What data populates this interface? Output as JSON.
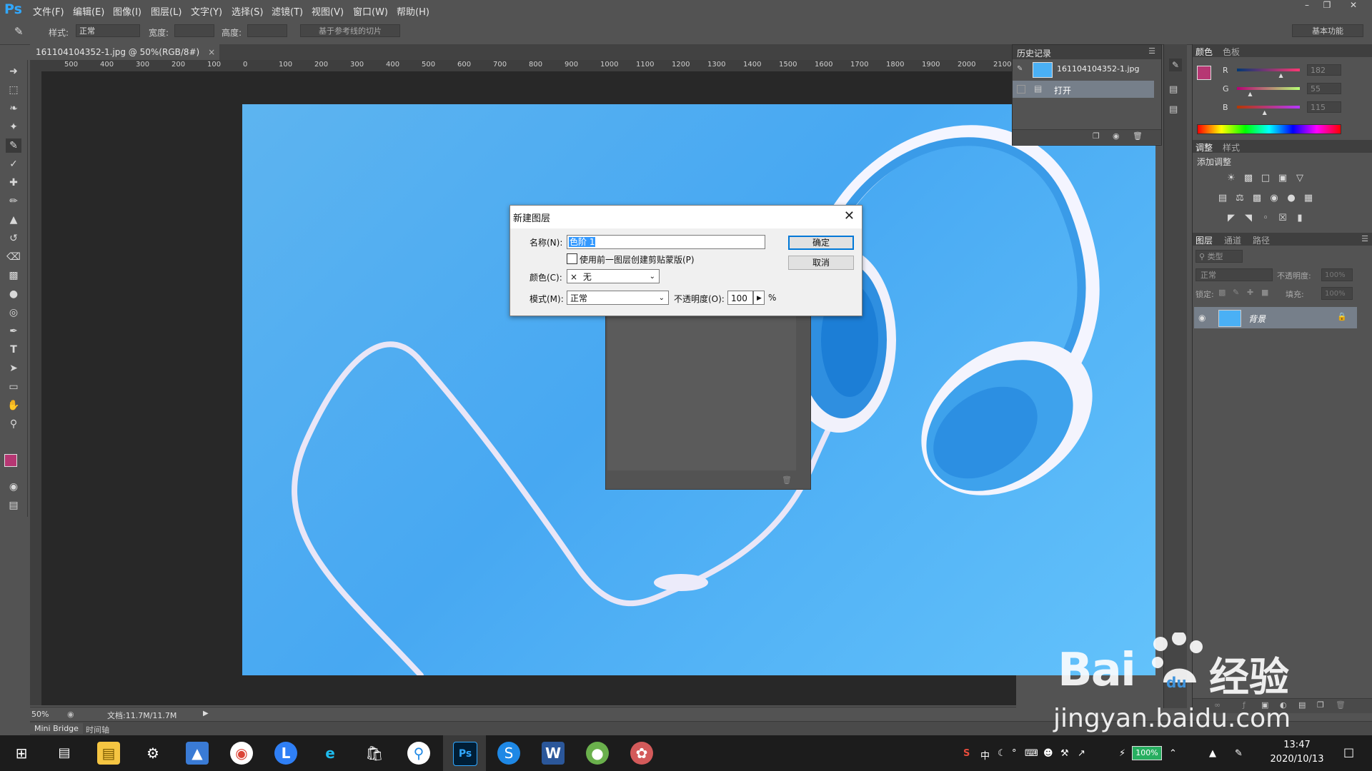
{
  "app": {
    "logo": "Ps",
    "menus": [
      "文件(F)",
      "编辑(E)",
      "图像(I)",
      "图层(L)",
      "文字(Y)",
      "选择(S)",
      "滤镜(T)",
      "视图(V)",
      "窗口(W)",
      "帮助(H)"
    ],
    "workspace": "基本功能"
  },
  "options_bar": {
    "style_label": "样式:",
    "style_value": "正常",
    "width_label": "宽度:",
    "height_label": "高度:",
    "slice_button": "基于参考线的切片"
  },
  "document": {
    "tab_title": "161104104352-1.jpg @ 50%(RGB/8#)",
    "ruler_labels": [
      "500",
      "400",
      "300",
      "200",
      "100",
      "0",
      "100",
      "200",
      "300",
      "400",
      "500",
      "600",
      "700",
      "800",
      "900",
      "1000",
      "1100",
      "1200",
      "1300",
      "1400",
      "1500",
      "1600",
      "1700",
      "1800",
      "1900",
      "2000",
      "2100"
    ],
    "zoom": "50%",
    "doc_size": "文档:11.7M/11.7M"
  },
  "bottom_tabs": [
    "Mini Bridge",
    "时间轴"
  ],
  "history_panel": {
    "tab": "历史记录",
    "snapshot": "161104104352-1.jpg",
    "steps": [
      "打开"
    ]
  },
  "color_panel": {
    "tabs": [
      "颜色",
      "色板"
    ],
    "channels": [
      {
        "label": "R",
        "value": "182",
        "fraction": 0.71
      },
      {
        "label": "G",
        "value": "55",
        "fraction": 0.22
      },
      {
        "label": "B",
        "value": "115",
        "fraction": 0.45
      }
    ],
    "fg_color": "#b63773",
    "bg_color": "#ffffff"
  },
  "adjust_panel": {
    "tabs": [
      "调整",
      "样式"
    ],
    "title": "添加调整"
  },
  "layers_panel": {
    "tabs": [
      "图层",
      "通道",
      "路径"
    ],
    "filter_kind": "类型",
    "blend_mode": "正常",
    "opacity_label": "不透明度:",
    "opacity_value": "100%",
    "lock_label": "锁定:",
    "fill_label": "填充:",
    "fill_value": "100%",
    "layers": [
      {
        "name": "背景"
      }
    ]
  },
  "dialog": {
    "title": "新建图层",
    "name_label": "名称(N):",
    "name_value": "色阶 1",
    "clip_checkbox": "使用前一图层创建剪贴蒙版(P)",
    "color_label": "颜色(C):",
    "color_x": "×",
    "color_value": "无",
    "mode_label": "模式(M):",
    "mode_value": "正常",
    "opacity_label": "不透明度(O):",
    "opacity_value": "100",
    "percent": "%",
    "ok": "确定",
    "cancel": "取消"
  },
  "taskbar": {
    "tray": {
      "ime": "中",
      "battery": "100%"
    },
    "time": "13:47",
    "date": "2020/10/13"
  },
  "watermark": {
    "brand_left": "Bai",
    "brand_mid": "du",
    "brand_right": "经验",
    "url": "jingyan.baidu.com"
  }
}
